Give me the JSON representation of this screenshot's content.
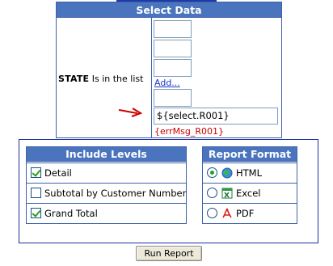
{
  "select_data": {
    "title": "Select Data",
    "field_name": "STATE",
    "operator_text": "Is in the list",
    "list_values": [
      "",
      "",
      "",
      ""
    ],
    "add_link": "Add...",
    "param_value": "${select.R001}",
    "error_message": "{errMsg_R001}"
  },
  "include_levels": {
    "title": "Include Levels",
    "items": [
      {
        "label": "Detail",
        "checked": true
      },
      {
        "label": "Subtotal by Customer Number",
        "checked": false
      },
      {
        "label": "Grand Total",
        "checked": true
      }
    ]
  },
  "report_format": {
    "title": "Report Format",
    "options": [
      {
        "label": "HTML",
        "icon": "html-globe-icon",
        "selected": true
      },
      {
        "label": "Excel",
        "icon": "excel-icon",
        "selected": false
      },
      {
        "label": "PDF",
        "icon": "pdf-icon",
        "selected": false
      }
    ]
  },
  "actions": {
    "run_label": "Run Report"
  },
  "colors": {
    "header_bg": "#4a74bd",
    "border": "#3e62a8",
    "check_green": "#21a121",
    "error_red": "#cc0000",
    "link_blue": "#1a35c4"
  }
}
